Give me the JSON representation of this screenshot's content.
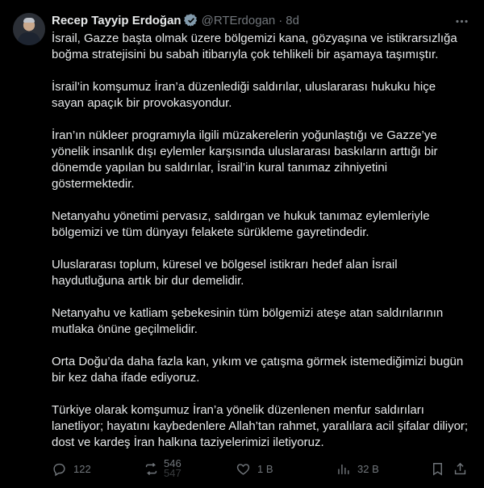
{
  "author": {
    "name": "Recep Tayyip Erdoğan",
    "handle": "@RTErdogan",
    "separator": "·",
    "time": "8d"
  },
  "tweet": {
    "paragraphs": [
      "İsrail, Gazze başta olmak üzere bölgemizi kana, gözyaşına ve istikrarsızlığa boğma stratejisini bu sabah itibarıyla çok tehlikeli bir aşamaya taşımıştır.",
      "İsrail’in komşumuz İran’a düzenlediği saldırılar, uluslararası hukuku hiçe sayan apaçık bir provokasyondur.",
      "İran’ın nükleer programıyla ilgili müzakerelerin yoğunlaştığı ve Gazze’ye yönelik insanlık dışı eylemler karşısında uluslararası baskıların arttığı bir dönemde yapılan bu saldırılar, İsrail’in kural tanımaz zihniyetini göstermektedir.",
      "Netanyahu yönetimi pervasız, saldırgan ve hukuk tanımaz eylemleriyle bölgemizi ve tüm dünyayı felakete sürükleme gayretindedir.",
      "Uluslararası toplum, küresel ve bölgesel istikrarı hedef alan İsrail haydutluğuna artık bir dur demelidir.",
      "Netanyahu ve katliam şebekesinin tüm bölgemizi ateşe atan saldırılarının mutlaka önüne geçilmelidir.",
      "Orta Doğu’da daha fazla kan, yıkım ve çatışma görmek istemediğimizi bugün bir kez daha ifade ediyoruz.",
      "Türkiye olarak komşumuz İran’a yönelik düzenlenen menfur saldırıları lanetliyor; hayatını kaybedenlere Allah’tan rahmet, yaralılara acil şifalar diliyor; dost ve kardeş İran halkına taziyelerimizi iletiyoruz."
    ]
  },
  "actions": {
    "replies": "122",
    "reposts_top": "546",
    "reposts_bottom": "547",
    "likes": "1 B",
    "views": "32 B"
  },
  "colors": {
    "background": "#000000",
    "text": "#e7e9ea",
    "muted": "#71767b",
    "verified": "#829aab"
  }
}
